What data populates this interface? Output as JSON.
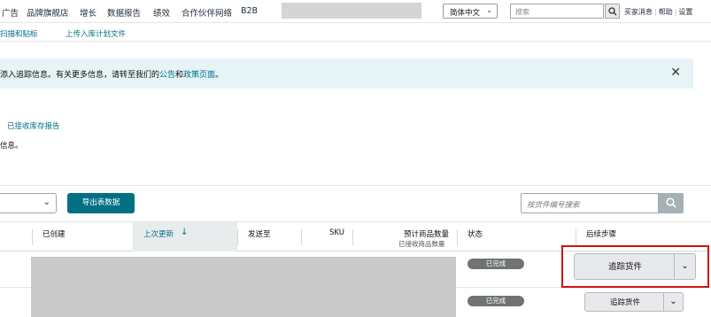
{
  "topnav": {
    "items": [
      "广告",
      "品牌旗舰店",
      "增长",
      "数据报告",
      "绩效",
      "合作伙伴网络",
      "B2B"
    ],
    "language": "简体中文",
    "search_placeholder": "搜索",
    "links": [
      "买家消息",
      "帮助",
      "设置"
    ]
  },
  "subnav": {
    "items": [
      "扫描和贴标",
      "上传入库计划文件"
    ]
  },
  "banner": {
    "text_before": "添入追踪信息。有关更多信息，请转至我们的",
    "link1": "公告",
    "text_mid": "和",
    "link2": "政策页面",
    "text_after": "。"
  },
  "report_link": "已接收库存报告",
  "info_text": "信息。",
  "toolbar": {
    "export_label": "导出表数据",
    "search_placeholder": "按货件编号搜索"
  },
  "table": {
    "headers": {
      "created": "已创建",
      "last_updated": "上次更新",
      "ship_to": "发送至",
      "sku": "SKU",
      "expected_qty": "预计商品数量",
      "expected_qty_sub": "已接收商品数量",
      "status": "状态",
      "next_steps": "后续步骤"
    },
    "rows": [
      {
        "status": "已完成",
        "action": "追踪货件"
      },
      {
        "status": "已完成",
        "action": "追踪货件"
      }
    ]
  },
  "colors": {
    "accent": "#007185",
    "highlight": "#d10f0f",
    "banner_bg": "#e6f4f6"
  }
}
